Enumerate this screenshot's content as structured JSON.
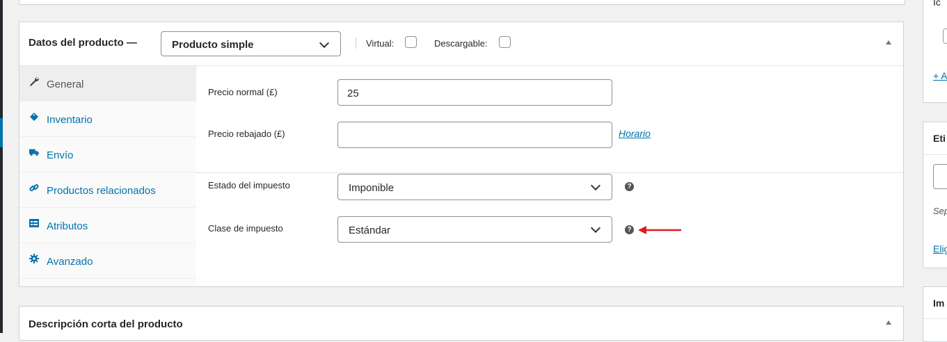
{
  "product_data": {
    "title": "Datos del producto —",
    "product_type": "Producto simple",
    "virtual_label": "Virtual:",
    "downloadable_label": "Descargable:"
  },
  "tabs": [
    {
      "label": "General",
      "icon": "wrench-icon"
    },
    {
      "label": "Inventario",
      "icon": "tag-icon"
    },
    {
      "label": "Envío",
      "icon": "truck-icon"
    },
    {
      "label": "Productos relacionados",
      "icon": "link-icon"
    },
    {
      "label": "Atributos",
      "icon": "list-icon"
    },
    {
      "label": "Avanzado",
      "icon": "gear-icon"
    }
  ],
  "general": {
    "regular_price_label": "Precio normal (£)",
    "regular_price_value": "25",
    "sale_price_label": "Precio rebajado (£)",
    "sale_price_value": "",
    "schedule_link": "Horario",
    "tax_status_label": "Estado del impuesto",
    "tax_status_value": "Imponible",
    "tax_class_label": "Clase de impuesto",
    "tax_class_value": "Estándar",
    "help_glyph": "?"
  },
  "short_description": {
    "title": "Descripción corta del producto"
  },
  "sidebar": {
    "partial_top": "Ic",
    "add_link": "+ A",
    "tags_title": "Eti",
    "separator_hint": "Sep",
    "choose_link": "Elig",
    "image_title": "Im"
  },
  "colors": {
    "link": "#0073aa",
    "annotation_arrow": "#e01b1b"
  }
}
